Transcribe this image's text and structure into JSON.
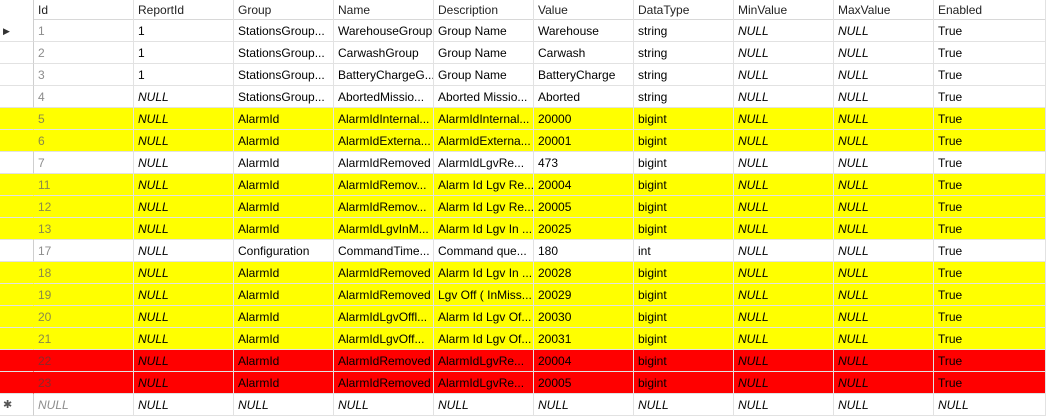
{
  "grid": {
    "columns": [
      "Id",
      "ReportId",
      "Group",
      "Name",
      "Description",
      "Value",
      "DataType",
      "MinValue",
      "MaxValue",
      "Enabled"
    ],
    "rows": [
      {
        "hl": "none",
        "cells": [
          "1",
          "1",
          "StationsGroup...",
          "WarehouseGroup",
          "Group Name",
          "Warehouse",
          "string",
          "NULL",
          "NULL",
          "True"
        ]
      },
      {
        "hl": "none",
        "cells": [
          "2",
          "1",
          "StationsGroup...",
          "CarwashGroup",
          "Group Name",
          "Carwash",
          "string",
          "NULL",
          "NULL",
          "True"
        ]
      },
      {
        "hl": "none",
        "cells": [
          "3",
          "1",
          "StationsGroup...",
          "BatteryChargeG...",
          "Group Name",
          "BatteryCharge",
          "string",
          "NULL",
          "NULL",
          "True"
        ]
      },
      {
        "hl": "none",
        "cells": [
          "4",
          "NULL",
          "StationsGroup...",
          "AbortedMissio...",
          "Aborted Missio...",
          "Aborted",
          "string",
          "NULL",
          "NULL",
          "True"
        ]
      },
      {
        "hl": "yellow",
        "cells": [
          "5",
          "NULL",
          "AlarmId",
          "AlarmIdInternal...",
          "AlarmIdInternal...",
          "20000",
          "bigint",
          "NULL",
          "NULL",
          "True"
        ]
      },
      {
        "hl": "yellow",
        "cells": [
          "6",
          "NULL",
          "AlarmId",
          "AlarmIdExterna...",
          "AlarmIdExterna...",
          "20001",
          "bigint",
          "NULL",
          "NULL",
          "True"
        ]
      },
      {
        "hl": "none",
        "cells": [
          "7",
          "NULL",
          "AlarmId",
          "AlarmIdRemoved",
          "AlarmIdLgvRe...",
          "473",
          "bigint",
          "NULL",
          "NULL",
          "True"
        ]
      },
      {
        "hl": "yellow",
        "cells": [
          "11",
          "NULL",
          "AlarmId",
          "AlarmIdRemov...",
          "Alarm Id Lgv Re...",
          "20004",
          "bigint",
          "NULL",
          "NULL",
          "True"
        ]
      },
      {
        "hl": "yellow",
        "cells": [
          "12",
          "NULL",
          "AlarmId",
          "AlarmIdRemov...",
          "Alarm Id Lgv Re...",
          "20005",
          "bigint",
          "NULL",
          "NULL",
          "True"
        ]
      },
      {
        "hl": "yellow",
        "cells": [
          "13",
          "NULL",
          "AlarmId",
          "AlarmIdLgvInM...",
          "Alarm Id Lgv In ...",
          "20025",
          "bigint",
          "NULL",
          "NULL",
          "True"
        ]
      },
      {
        "hl": "none",
        "cells": [
          "17",
          "NULL",
          "Configuration",
          "CommandTime...",
          "Command que...",
          "180",
          "int",
          "NULL",
          "NULL",
          "True"
        ]
      },
      {
        "hl": "yellow",
        "cells": [
          "18",
          "NULL",
          "AlarmId",
          "AlarmIdRemoved",
          "Alarm Id Lgv In ...",
          "20028",
          "bigint",
          "NULL",
          "NULL",
          "True"
        ]
      },
      {
        "hl": "yellow",
        "cells": [
          "19",
          "NULL",
          "AlarmId",
          "AlarmIdRemoved",
          "Lgv Off ( InMiss...",
          "20029",
          "bigint",
          "NULL",
          "NULL",
          "True"
        ]
      },
      {
        "hl": "yellow",
        "cells": [
          "20",
          "NULL",
          "AlarmId",
          "AlarmIdLgvOffl...",
          "Alarm Id Lgv Of...",
          "20030",
          "bigint",
          "NULL",
          "NULL",
          "True"
        ]
      },
      {
        "hl": "yellow",
        "cells": [
          "21",
          "NULL",
          "AlarmId",
          "AlarmIdLgvOff...",
          "Alarm Id Lgv Of...",
          "20031",
          "bigint",
          "NULL",
          "NULL",
          "True"
        ]
      },
      {
        "hl": "red",
        "cells": [
          "22",
          "NULL",
          "AlarmId",
          "AlarmIdRemoved",
          "AlarmIdLgvRe...",
          "20004",
          "bigint",
          "NULL",
          "NULL",
          "True"
        ]
      },
      {
        "hl": "red",
        "cells": [
          "23",
          "NULL",
          "AlarmId",
          "AlarmIdRemoved",
          "AlarmIdLgvRe...",
          "20005",
          "bigint",
          "NULL",
          "NULL",
          "True"
        ]
      }
    ],
    "new_row": [
      "NULL",
      "NULL",
      "NULL",
      "NULL",
      "NULL",
      "NULL",
      "NULL",
      "NULL",
      "NULL",
      "NULL"
    ],
    "current_row_marker": "▶",
    "new_row_marker": "✱",
    "colors": {
      "yellow": "#ffff00",
      "red": "#ff0000"
    }
  }
}
